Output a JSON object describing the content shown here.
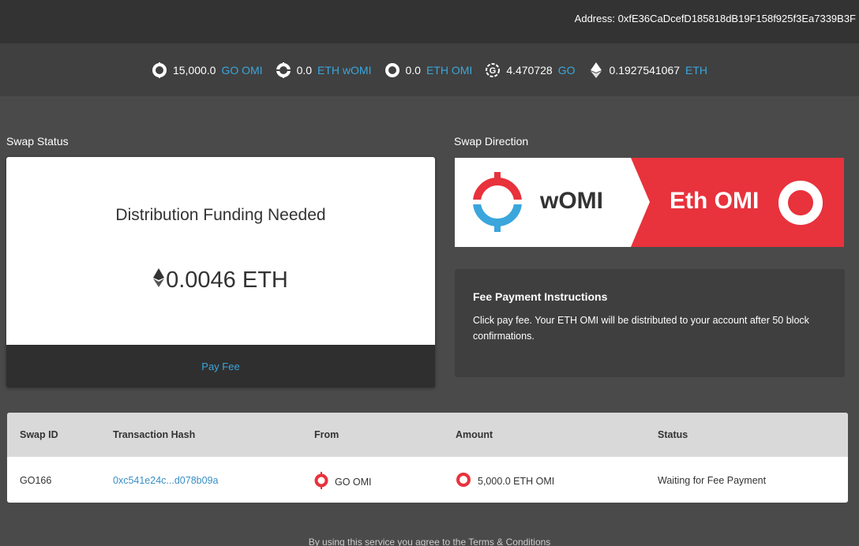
{
  "header": {
    "address_label": "Address:",
    "address_value": "0xfE36CaDcefD185818dB19F158f925f3Ea7339B3F"
  },
  "balances": [
    {
      "amount": "15,000.0",
      "unit": "GO OMI",
      "icon": "go-omi-icon"
    },
    {
      "amount": "0.0",
      "unit": "ETH wOMI",
      "icon": "womi-icon"
    },
    {
      "amount": "0.0",
      "unit": "ETH OMI",
      "icon": "eth-omi-icon"
    },
    {
      "amount": "4.470728",
      "unit": "GO",
      "icon": "gochain-icon"
    },
    {
      "amount": "0.1927541067",
      "unit": "ETH",
      "icon": "ethereum-icon"
    }
  ],
  "swap_status": {
    "label": "Swap Status",
    "title": "Distribution Funding Needed",
    "amount": "0.0046 ETH",
    "pay_fee_label": "Pay Fee"
  },
  "swap_direction": {
    "label": "Swap Direction",
    "from": "wOMI",
    "to": "Eth OMI"
  },
  "fee_instructions": {
    "title": "Fee Payment Instructions",
    "body": "Click pay fee. Your ETH OMI will be distributed to your account after 50 block confirmations."
  },
  "table": {
    "headers": [
      "Swap ID",
      "Transaction Hash",
      "From",
      "Amount",
      "Status"
    ],
    "rows": [
      {
        "swap_id": "GO166",
        "tx_hash": "0xc541e24c...d078b09a",
        "from": "GO OMI",
        "amount": "5,000.0 ETH OMI",
        "status": "Waiting for Fee Payment"
      }
    ]
  },
  "footer": {
    "text": "By using this service you agree to the",
    "link": "Terms & Conditions"
  },
  "colors": {
    "accent_blue": "#3aa6dc",
    "brand_red": "#e8323c",
    "topbar": "#333333",
    "background": "#4a4a4a"
  }
}
